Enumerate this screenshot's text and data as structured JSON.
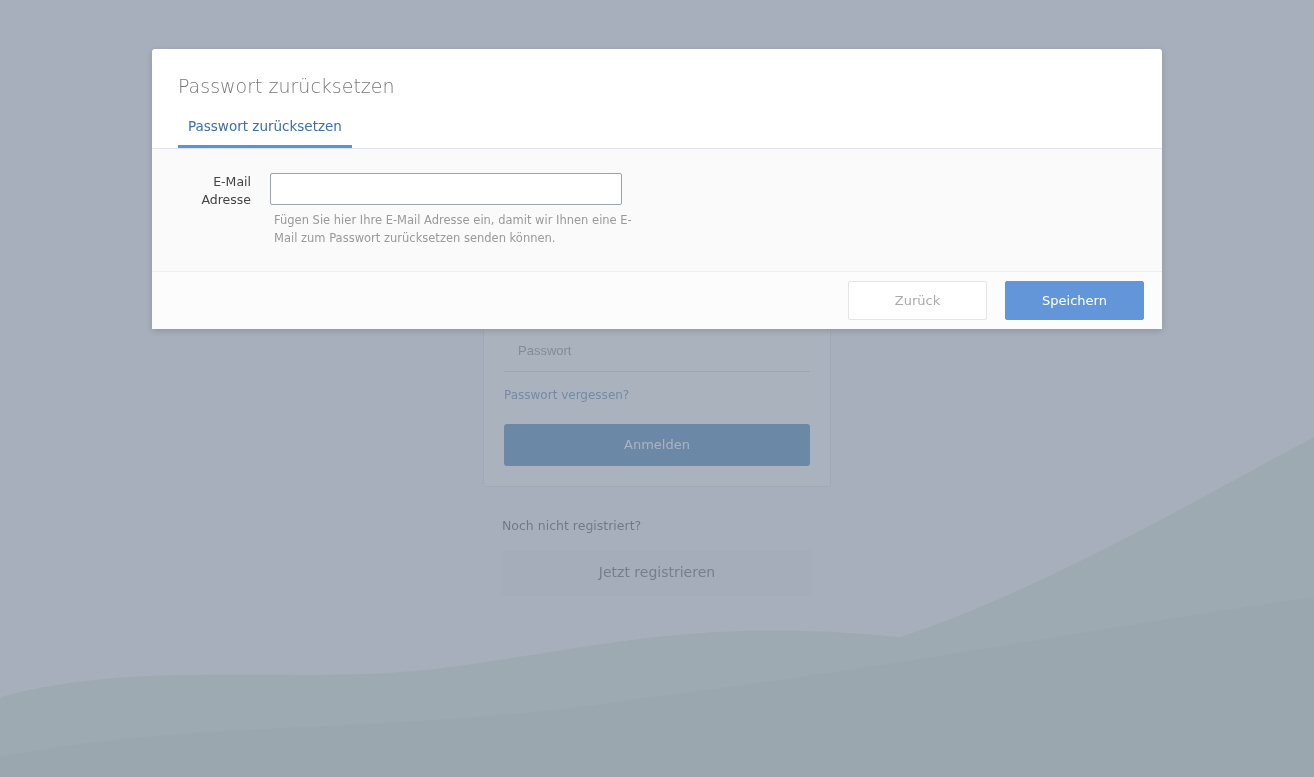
{
  "login": {
    "password_placeholder": "Passwort",
    "forgot_link": "Passwort vergessen?",
    "login_button": "Anmelden",
    "register_prompt": "Noch nicht registriert?",
    "register_button": "Jetzt registrieren"
  },
  "modal": {
    "title": "Passwort zurücksetzen",
    "tabs": [
      {
        "label": "Passwort zurücksetzen",
        "selected": true
      }
    ],
    "fields": [
      {
        "label": "E-Mail Adresse",
        "help": "Fügen Sie hier Ihre E-Mail Adresse ein, damit wir Ihnen eine E-Mail zum Passwort zurücksetzen senden können."
      }
    ],
    "buttons": [
      {
        "label": "Zurück",
        "kind": "secondary"
      },
      {
        "label": "Speichern",
        "kind": "primary"
      }
    ]
  }
}
